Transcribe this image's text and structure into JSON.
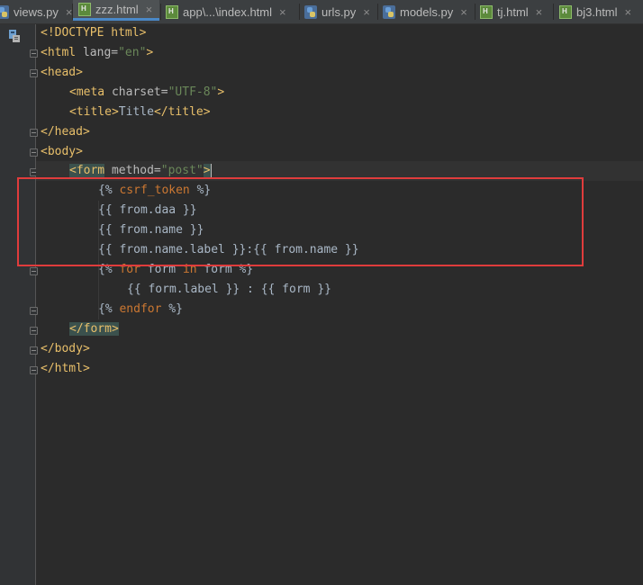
{
  "tabs": [
    {
      "label": "views.py",
      "icon": "python-file-icon",
      "active": false
    },
    {
      "label": "zzz.html",
      "icon": "html-file-icon",
      "active": true
    },
    {
      "label": "app\\...\\index.html",
      "icon": "html-file-icon",
      "active": false
    },
    {
      "label": "urls.py",
      "icon": "python-file-icon",
      "active": false
    },
    {
      "label": "models.py",
      "icon": "python-file-icon",
      "active": false
    },
    {
      "label": "tj.html",
      "icon": "html-file-icon",
      "active": false
    },
    {
      "label": "bj3.html",
      "icon": "html-file-icon",
      "active": false
    }
  ],
  "close_glyph": "×",
  "code": {
    "l1": {
      "a": "<!DOCTYPE html>"
    },
    "l2": {
      "open": "<html ",
      "attr": "lang=",
      "val": "\"en\"",
      "close": ">"
    },
    "l3": {
      "tag": "<head>"
    },
    "l4": {
      "open": "<meta ",
      "attr": "charset=",
      "val": "\"UTF-8\"",
      "close": ">"
    },
    "l5": {
      "open": "<title>",
      "text": "Title",
      "close": "</title>"
    },
    "l6": {
      "tag": "</head>"
    },
    "l7": {
      "tag": "<body>"
    },
    "l8": {
      "open": "<form",
      "attr": " method=",
      "val": "\"post\"",
      "close": ">"
    },
    "l9": {
      "a": "{% ",
      "kw": "csrf_token",
      "b": " %}"
    },
    "l10": {
      "text": "{{ from.daa }}"
    },
    "l11": {
      "text": "{{ from.name }}"
    },
    "l12": {
      "text": "{{ from.name.label }}:{{ from.name }}"
    },
    "l13": {
      "a": "{% ",
      "kw1": "for",
      "b": " form ",
      "kw2": "in",
      "c": " form %}"
    },
    "l14": {
      "text": "{{ form.label }} : {{ form }}"
    },
    "l15": {
      "a": "{% ",
      "kw": "endfor",
      "b": " %}"
    },
    "l16": {
      "tag": "</form>"
    },
    "l17": {
      "tag": "</body>"
    },
    "l18": {
      "tag": "</html>"
    }
  },
  "colors": {
    "highlight_box": "#e03c3c",
    "tag": "#e8bf6a",
    "string": "#6a8759",
    "keyword": "#cc7832",
    "background": "#2b2b2b"
  }
}
